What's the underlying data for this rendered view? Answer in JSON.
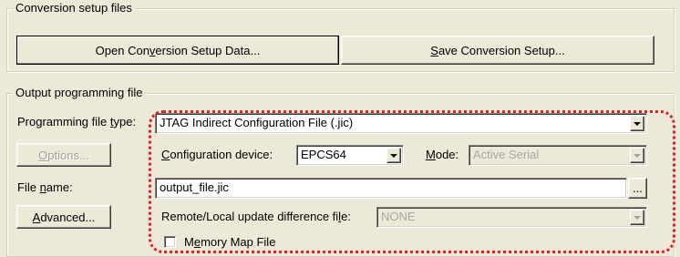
{
  "conversion_group": {
    "title": "Conversion setup files",
    "open_button": "Open Conversion Setup Data...",
    "save_button": "Save Conversion Setup..."
  },
  "output_group": {
    "title": "Output programming file",
    "programming_file_type_label": "Programming file type:",
    "programming_file_type_value": "JTAG Indirect Configuration File (.jic)",
    "options_button": "Options...",
    "configuration_device_label": "Configuration device:",
    "configuration_device_value": "EPCS64",
    "mode_label": "Mode:",
    "mode_value": "Active Serial",
    "file_name_label": "File name:",
    "file_name_value": "output_file.jic",
    "browse_button": "...",
    "advanced_button": "Advanced...",
    "remote_local_label": "Remote/Local update difference file:",
    "remote_local_value": "NONE",
    "memory_map_label": "Memory Map File"
  },
  "colors": {
    "highlight": "#e02020",
    "window_bg": "#ece9d8"
  }
}
